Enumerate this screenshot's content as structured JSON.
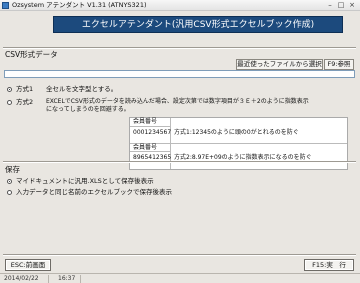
{
  "window": {
    "title": "Ozsystem アテンダント V1.31 (ATNYS321)",
    "controls": [
      "–",
      "□",
      "×"
    ]
  },
  "header": {
    "banner": "エクセルアテンダント(汎用CSV形式エクセルブック作成)"
  },
  "csv_section": {
    "label": "CSV形式データ",
    "recent_button": "最近使ったファイルから選択",
    "f9_button": "F9:参照",
    "file_input_value": "",
    "method1": {
      "label": "方式1",
      "description": "全セルを文字型とする。",
      "selected": true
    },
    "method2": {
      "label": "方式2",
      "description_line1": "EXCELでCSV形式のデータを読み込んだ場合、設定次第では数字項目が３Ｅ＋2のように指数表示",
      "description_line2": "になってしまうのを回避する。",
      "selected": false
    },
    "examples": [
      {
        "header": "会員番号",
        "value": "0001234567",
        "note": "方式1:12345のように頭の0がとれるのを防ぐ"
      },
      {
        "header": "会員番号",
        "value": "8965412365",
        "note": "方式2:8.97E+09のように指数表示になるのを防ぐ"
      }
    ]
  },
  "save_section": {
    "label": "保存",
    "option1": {
      "label": "マイドキュメントに汎用.XLSとして保存後表示",
      "selected": true
    },
    "option2": {
      "label": "入力データと同じ名前のエクセルブックで保存後表示",
      "selected": false
    }
  },
  "footer": {
    "esc_button": "ESC:前画面",
    "f15_button": "F15:実　行"
  },
  "statusbar": {
    "date": "2014/02/22",
    "time": "16:37"
  }
}
